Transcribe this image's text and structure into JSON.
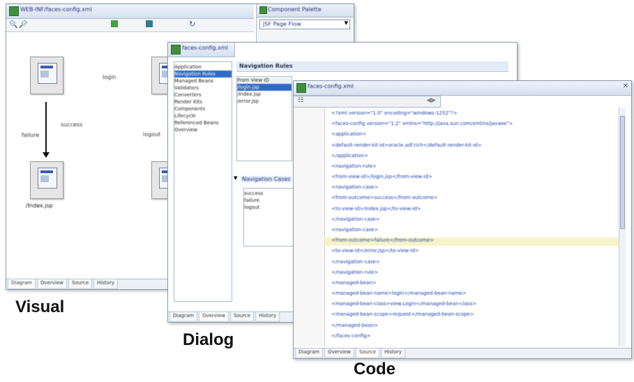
{
  "captions": {
    "visual": "Visual",
    "dialog": "Dialog",
    "code": "Code"
  },
  "visual_window": {
    "title": "WEB-INF/faces-config.xml",
    "panel_title": "Component Palette",
    "panel_dropdown": "JSF Page Flow",
    "node_labels": [
      "",
      "",
      "/Index.jsp",
      ""
    ],
    "edge_labels": [
      "login",
      "success",
      "failure",
      "logout"
    ],
    "tabs": [
      "Diagram",
      "Overview",
      "Source",
      "History"
    ]
  },
  "dialog_window": {
    "title": "faces-config.xml",
    "left_items": [
      "Application",
      "Navigation Rules",
      "Managed Beans",
      "Validators",
      "Converters",
      "Render Kits",
      "Components",
      "Lifecycle",
      "Referenced Beans",
      "Overview"
    ],
    "selected_index": 1,
    "header": "Navigation Rules",
    "rules": [
      "From View ID",
      "/login.jsp",
      "/index.jsp",
      "/error.jsp"
    ],
    "selected_rule_index": 1,
    "cases_header": "Navigation Cases",
    "cases": [
      "success",
      "failure",
      "logout"
    ],
    "tabs": [
      "Diagram",
      "Overview",
      "Source",
      "History"
    ]
  },
  "code_window": {
    "title": "faces-config.xml",
    "toolbar_icon": "split-icon",
    "lines": [
      "<?xml version=\"1.0\" encoding=\"windows-1252\"?>",
      "<faces-config version=\"1.2\" xmlns=\"http://java.sun.com/xml/ns/javaee\">",
      "  <application>",
      "    <default-render-kit-id>oracle.adf.rich</default-render-kit-id>",
      "  </application>",
      "  <navigation-rule>",
      "    <from-view-id>/login.jsp</from-view-id>",
      "    <navigation-case>",
      "      <from-outcome>success</from-outcome>",
      "      <to-view-id>/index.jsp</to-view-id>",
      "    </navigation-case>",
      "    <navigation-case>",
      "      <from-outcome>failure</from-outcome>",
      "      <to-view-id>/error.jsp</to-view-id>",
      "    </navigation-case>",
      "  </navigation-rule>",
      "  <managed-bean>",
      "    <managed-bean-name>login</managed-bean-name>",
      "    <managed-bean-class>view.Login</managed-bean-class>",
      "    <managed-bean-scope>request</managed-bean-scope>",
      "  </managed-bean>",
      "</faces-config>"
    ],
    "highlight_line": 12,
    "tabs": [
      "Diagram",
      "Overview",
      "Source",
      "History"
    ],
    "active_tab": 2
  }
}
